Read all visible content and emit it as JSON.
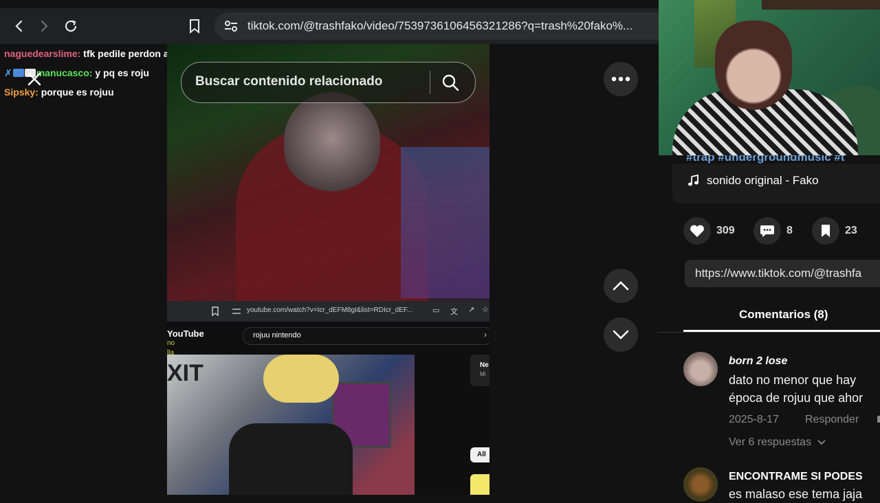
{
  "browser": {
    "url": "tiktok.com/@trashfako/video/7539736106456321286?q=trash%20fako%..."
  },
  "chat": [
    {
      "user": "naguedearslime:",
      "message": "tfk pedile perdon a sipsky q esta llorando",
      "color": "#e0637f"
    },
    {
      "user": "manucasco:",
      "message": "y pq es roju",
      "color": "#5be35b"
    },
    {
      "user": "Sipsky:",
      "message": "porque es rojuu",
      "color": "#f0a040"
    }
  ],
  "video": {
    "inner_url": "youtube.com/watch?v=Icr_dEFM8gI&list=RDIcr_dEF...",
    "yt_logo": "YouTube",
    "yt_query": "rojuu nintendo",
    "yt_chip": "All",
    "yt_side_label": "Ne",
    "yt_side_label2": "Mi",
    "left_labels": [
      "no",
      "lla"
    ]
  },
  "search": {
    "placeholder": "Buscar contenido relacionado"
  },
  "post": {
    "hashtags": "#trap #undergroundmusic #t",
    "sound": "sonido original - Fako",
    "likes": "309",
    "comments": "8",
    "saves": "23",
    "link": "https://www.tiktok.com/@trashfa"
  },
  "comments_tab": {
    "label": "Comentarios (8)"
  },
  "comments": [
    {
      "name": "born 2 lose",
      "text_line1": "dato no menor que hay",
      "text_line2": "época de rojuu que ahor",
      "date": "2025-8-17",
      "reply": "Responder",
      "view_replies": "Ver 6 respuestas"
    },
    {
      "name": "ENCONTRAME SI PODES",
      "text_line1": "es malaso ese tema jaja"
    }
  ]
}
